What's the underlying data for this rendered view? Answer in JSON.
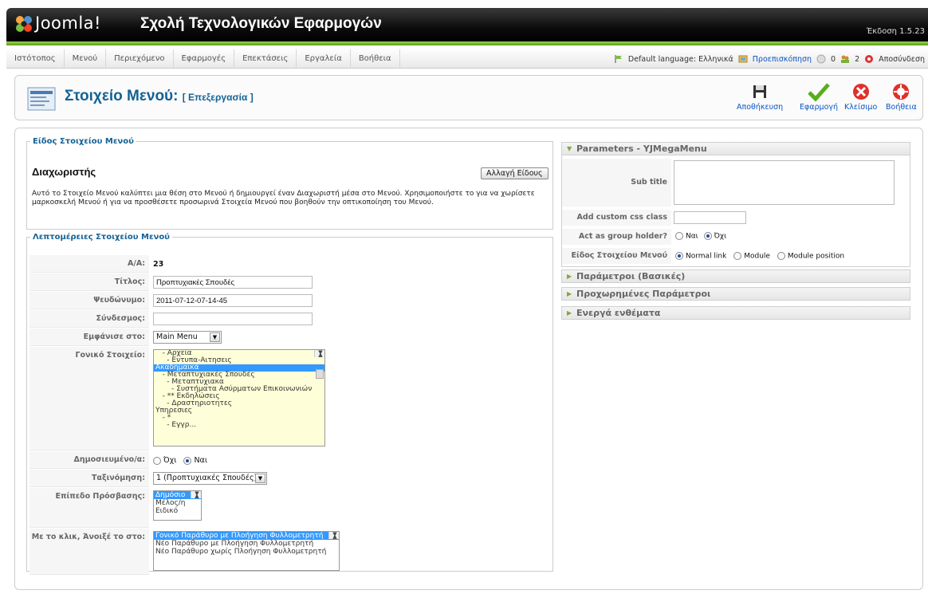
{
  "header": {
    "logo_text": "Joomla!",
    "site_title": "Σχολή Τεχνολογικών Εφαρμογών",
    "version": "Έκδοση 1.5.23"
  },
  "menu": {
    "items": [
      "Ιστότοπος",
      "Μενού",
      "Περιεχόμενο",
      "Εφαρμογές",
      "Επεκτάσεις",
      "Εργαλεία",
      "Βοήθεια"
    ]
  },
  "status": {
    "default_language": "Default language: Ελληνικά",
    "preview": "Προεπισκόπηση",
    "messages": "0",
    "users": "2",
    "logout": "Αποσύνδεση"
  },
  "toolbar": {
    "title": "Στοιχείο Μενού:",
    "subtitle": "[ Επεξεργασία ]",
    "save": "Αποθήκευση",
    "apply": "Εφαρμογή",
    "close": "Κλείσιμο",
    "help": "Βοήθεια"
  },
  "type_section": {
    "legend": "Είδος Στοιχείου Μενού",
    "name": "Διαχωριστής",
    "change_button": "Αλλαγή Είδους",
    "description": "Αυτό το Στοιχείο Μενού καλύπτει μια θέση στο Μενού ή δημιουργεί έναν Διαχωριστή μέσα στο Μενού. Χρησιμοποιήστε το για να χωρίσετε μαρκοσκελή Μενού ή για να προσθέσετε προσωρινά Στοιχεία Μενού που βοηθούν την οπτικοποίηση του Μενού."
  },
  "details": {
    "legend": "Λεπτομέρειες Στοιχείου Μενού",
    "id_label": "Α/Α:",
    "id_value": "23",
    "title_label": "Τίτλος:",
    "title_value": "Προπτυχιακές Σπουδές",
    "alias_label": "Ψευδώνυμο:",
    "alias_value": "2011-07-12-07-14-45",
    "link_label": "Σύνδεσμος:",
    "link_value": "",
    "display_in_label": "Εμφάνισε στο:",
    "display_in_value": "Main Menu",
    "parent_label": "Γονικό Στοιχείο:",
    "parent_items": [
      "   - Αρχεία",
      "     - Εντυπα-Αιτησεις",
      "Ακαδημαϊκά",
      "   - Μεταπτυχιακές Σπουδές",
      "     - Μεταπτυχιακα",
      "       - Συστήματα Ασύρματων Επικοινωνιών",
      "   - ** Εκδηλώσεις",
      "     - Δραστηριοτητες",
      "Υπηρεσιες",
      "   - *",
      "     - Εγγρ..."
    ],
    "published_label": "Δημοσιευμένο/α:",
    "published_no": "Όχι",
    "published_yes": "Ναι",
    "order_label": "Ταξινόμηση:",
    "order_value": "1 (Προπτυχιακές Σπουδές)",
    "access_label": "Επίπεδο Πρόσβασης:",
    "access_items": [
      "Δημόσιο",
      "Μέλος/η",
      "Ειδικό"
    ],
    "onclick_label": "Με το κλικ, Άνοιξέ το στο:",
    "onclick_items": [
      "Γονικό Παράθυρο με Πλοήγηση Φυλλομετρητή",
      "Νέο Παράθυρο με Πλοήγηση Φυλλομετρητή",
      "Νέο Παράθυρο χωρίς Πλοήγηση Φυλλομετρητή"
    ]
  },
  "params": {
    "yj_title": "Parameters - YJMegaMenu",
    "subtitle_label": "Sub title",
    "css_label": "Add custom css class",
    "group_label": "Act as group holder?",
    "group_no": "Ναι",
    "group_yes": "Όχι",
    "type_label": "Είδος Στοιχείου Μενού",
    "type_opt1": "Normal link",
    "type_opt2": "Module",
    "type_opt3": "Module position",
    "basic": "Παράμετροι (Βασικές)",
    "advanced": "Προχωρημένες Παράμετροι",
    "components": "Ενεργά ενθέματα"
  },
  "colors": {
    "accent": "#146295",
    "link": "#0b55c4",
    "header_green": "#80a83e",
    "parent_bg": "#fefed8"
  }
}
